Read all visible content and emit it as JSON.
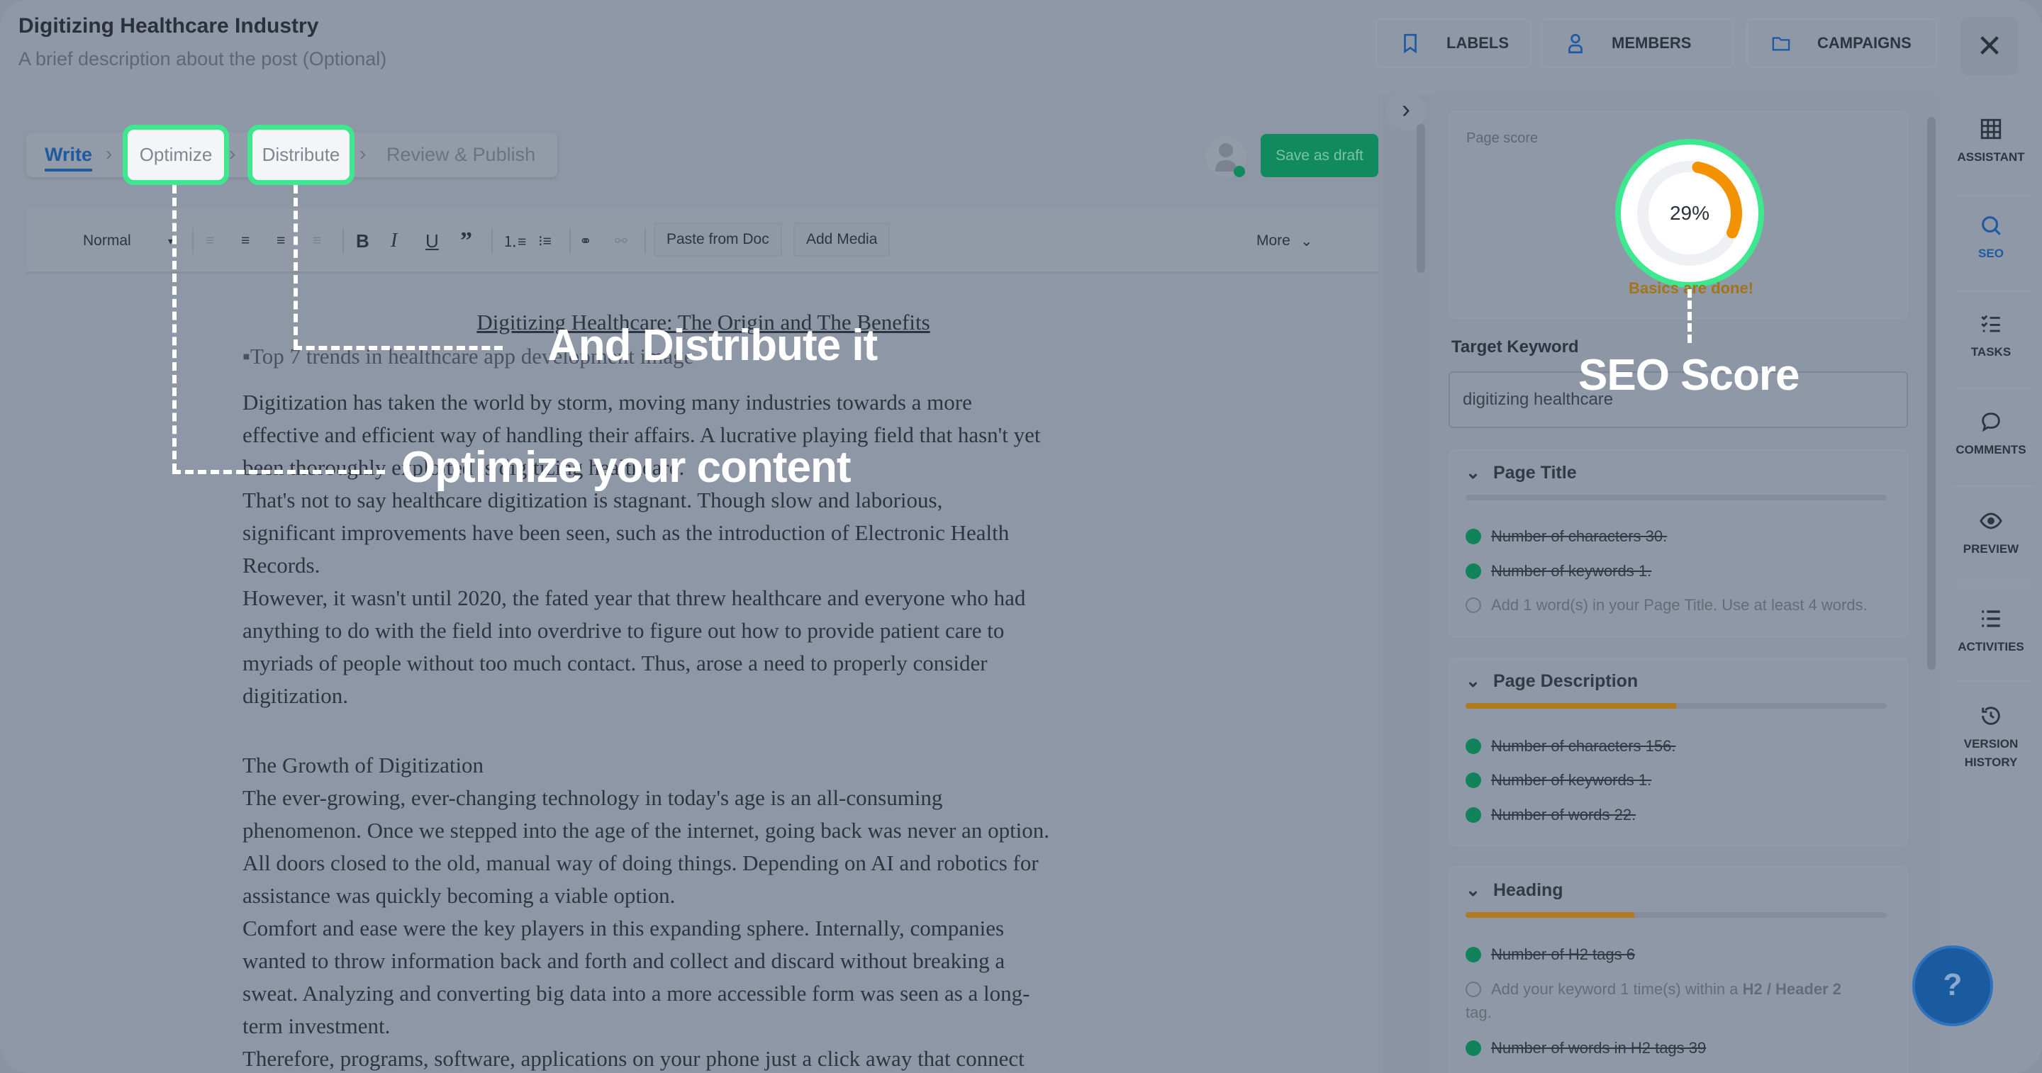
{
  "header": {
    "title": "Digitizing Healthcare Industry",
    "subtitle": "A brief description about the post (Optional)",
    "buttons": [
      {
        "label": "LABELS",
        "icon": "bookmark-icon"
      },
      {
        "label": "MEMBERS",
        "icon": "user-icon"
      },
      {
        "label": "CAMPAIGNS",
        "icon": "folder-icon"
      }
    ],
    "close": "✕"
  },
  "steps": [
    {
      "label": "Write",
      "active": true
    },
    {
      "label": "Optimize"
    },
    {
      "label": "Distribute"
    },
    {
      "label": "Review & Publish"
    }
  ],
  "save_draft": "Save as draft",
  "toolbar": {
    "format": "Normal",
    "paste": "Paste from Doc",
    "media": "Add Media",
    "more": "More",
    "icons": [
      "align-left-icon",
      "align-center-icon",
      "align-right-icon",
      "align-justify-icon",
      "bold-icon",
      "italic-icon",
      "underline-icon",
      "quote-icon",
      "ordered-list-icon",
      "bullet-list-icon",
      "link-icon",
      "unlink-icon"
    ]
  },
  "doc": {
    "heading": "Digitizing Healthcare: The Origin and The Benefits",
    "image_alt": "Top 7 trends in healthcare app development image",
    "lines": [
      "Digitization has taken the world by storm, moving many industries towards a more",
      "effective and efficient way of handling their affairs. A lucrative playing field that hasn't yet",
      "been thoroughly exploited is digitizing healthcare.",
      "That's not to say healthcare digitization is stagnant. Though slow and laborious,",
      "significant improvements have been seen, such as the introduction of Electronic Health",
      "Records.",
      "However, it wasn't until 2020, the fated year that threw healthcare and everyone who had",
      "anything to do with the field into overdrive to figure out how to provide patient care to",
      "myriads of people without too much contact. Thus, arose a need to properly consider",
      "digitization."
    ],
    "subheading": "The Growth of Digitization",
    "lines2": [
      "The ever-growing, ever-changing technology in today's age is an all-consuming",
      "phenomenon. Once we stepped into the age of the internet, going back was never an option.",
      "All doors closed to the old, manual way of doing things. Depending on AI and robotics for",
      "assistance was quickly becoming a viable option.",
      "Comfort and ease were the key players in this expanding sphere. Internally, companies",
      "wanted to throw information back and forth and collect and discard without breaking a",
      "sweat. Analyzing and converting big data into a more accessible form was seen as a long-",
      "term investment.",
      "Therefore, programs, software, applications on your phone just a click away that connect"
    ]
  },
  "annotations": {
    "optimize": "Optimize your content",
    "distribute": "And Distribute it",
    "seo": "SEO Score"
  },
  "seo": {
    "page_score_label": "Page score",
    "score": "29%",
    "score_value": 29,
    "score_color": "#f39200",
    "status": "Basics are done!",
    "target_keyword_label": "Target Keyword",
    "target_keyword": "digitizing healthcare",
    "sections": [
      {
        "title": "Page Title",
        "progress": 0,
        "items": [
          {
            "text": "Number of characters 30.",
            "done": true
          },
          {
            "text": "Number of keywords 1.",
            "done": true
          },
          {
            "text": "Add 1 word(s) in your Page Title. Use at least 4 words.",
            "done": false
          }
        ]
      },
      {
        "title": "Page Description",
        "progress": 50,
        "items": [
          {
            "text": "Number of characters 156.",
            "done": true
          },
          {
            "text": "Number of keywords 1.",
            "done": true
          },
          {
            "text": "Number of words 22.",
            "done": true
          }
        ]
      },
      {
        "title": "Heading",
        "progress": 40,
        "items": [
          {
            "text": "Number of H2 tags 6",
            "done": true
          },
          {
            "text": "Add your keyword 1 time(s) within a ",
            "bold": "H2 / Header 2",
            "tail": "tag.",
            "done": false
          },
          {
            "text": "Number of words in H2 tags 39",
            "done": true
          }
        ]
      }
    ]
  },
  "rail": [
    {
      "label": "ASSISTANT",
      "icon": "grid-icon"
    },
    {
      "label": "SEO",
      "icon": "search-icon",
      "active": true
    },
    {
      "label": "TASKS",
      "icon": "tasks-icon"
    },
    {
      "label": "COMMENTS",
      "icon": "comment-icon"
    },
    {
      "label": "PREVIEW",
      "icon": "eye-icon"
    },
    {
      "label": "ACTIVITIES",
      "icon": "list-icon"
    },
    {
      "label": "VERSION",
      "label2": "HISTORY",
      "icon": "history-icon"
    }
  ],
  "help": "?",
  "colors": {
    "accent": "#1f5aa0",
    "highlight": "#3ee88f",
    "save": "#118a5e",
    "progress": "#b07a1e"
  }
}
